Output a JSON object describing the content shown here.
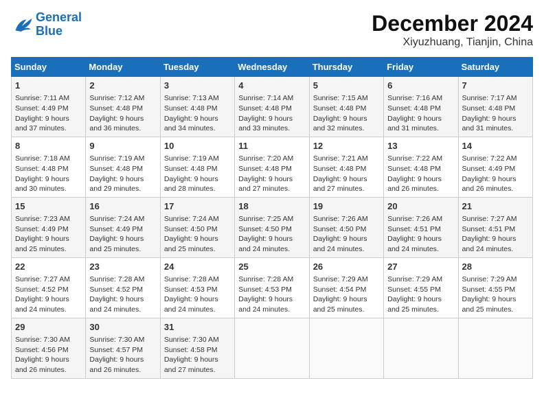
{
  "logo": {
    "line1": "General",
    "line2": "Blue"
  },
  "title": "December 2024",
  "subtitle": "Xiyuzhuang, Tianjin, China",
  "weekdays": [
    "Sunday",
    "Monday",
    "Tuesday",
    "Wednesday",
    "Thursday",
    "Friday",
    "Saturday"
  ],
  "weeks": [
    [
      {
        "day": 1,
        "sunrise": "7:11 AM",
        "sunset": "4:49 PM",
        "daylight": "9 hours and 37 minutes."
      },
      {
        "day": 2,
        "sunrise": "7:12 AM",
        "sunset": "4:48 PM",
        "daylight": "9 hours and 36 minutes."
      },
      {
        "day": 3,
        "sunrise": "7:13 AM",
        "sunset": "4:48 PM",
        "daylight": "9 hours and 34 minutes."
      },
      {
        "day": 4,
        "sunrise": "7:14 AM",
        "sunset": "4:48 PM",
        "daylight": "9 hours and 33 minutes."
      },
      {
        "day": 5,
        "sunrise": "7:15 AM",
        "sunset": "4:48 PM",
        "daylight": "9 hours and 32 minutes."
      },
      {
        "day": 6,
        "sunrise": "7:16 AM",
        "sunset": "4:48 PM",
        "daylight": "9 hours and 31 minutes."
      },
      {
        "day": 7,
        "sunrise": "7:17 AM",
        "sunset": "4:48 PM",
        "daylight": "9 hours and 31 minutes."
      }
    ],
    [
      {
        "day": 8,
        "sunrise": "7:18 AM",
        "sunset": "4:48 PM",
        "daylight": "9 hours and 30 minutes."
      },
      {
        "day": 9,
        "sunrise": "7:19 AM",
        "sunset": "4:48 PM",
        "daylight": "9 hours and 29 minutes."
      },
      {
        "day": 10,
        "sunrise": "7:19 AM",
        "sunset": "4:48 PM",
        "daylight": "9 hours and 28 minutes."
      },
      {
        "day": 11,
        "sunrise": "7:20 AM",
        "sunset": "4:48 PM",
        "daylight": "9 hours and 27 minutes."
      },
      {
        "day": 12,
        "sunrise": "7:21 AM",
        "sunset": "4:48 PM",
        "daylight": "9 hours and 27 minutes."
      },
      {
        "day": 13,
        "sunrise": "7:22 AM",
        "sunset": "4:48 PM",
        "daylight": "9 hours and 26 minutes."
      },
      {
        "day": 14,
        "sunrise": "7:22 AM",
        "sunset": "4:49 PM",
        "daylight": "9 hours and 26 minutes."
      }
    ],
    [
      {
        "day": 15,
        "sunrise": "7:23 AM",
        "sunset": "4:49 PM",
        "daylight": "9 hours and 25 minutes."
      },
      {
        "day": 16,
        "sunrise": "7:24 AM",
        "sunset": "4:49 PM",
        "daylight": "9 hours and 25 minutes."
      },
      {
        "day": 17,
        "sunrise": "7:24 AM",
        "sunset": "4:50 PM",
        "daylight": "9 hours and 25 minutes."
      },
      {
        "day": 18,
        "sunrise": "7:25 AM",
        "sunset": "4:50 PM",
        "daylight": "9 hours and 24 minutes."
      },
      {
        "day": 19,
        "sunrise": "7:26 AM",
        "sunset": "4:50 PM",
        "daylight": "9 hours and 24 minutes."
      },
      {
        "day": 20,
        "sunrise": "7:26 AM",
        "sunset": "4:51 PM",
        "daylight": "9 hours and 24 minutes."
      },
      {
        "day": 21,
        "sunrise": "7:27 AM",
        "sunset": "4:51 PM",
        "daylight": "9 hours and 24 minutes."
      }
    ],
    [
      {
        "day": 22,
        "sunrise": "7:27 AM",
        "sunset": "4:52 PM",
        "daylight": "9 hours and 24 minutes."
      },
      {
        "day": 23,
        "sunrise": "7:28 AM",
        "sunset": "4:52 PM",
        "daylight": "9 hours and 24 minutes."
      },
      {
        "day": 24,
        "sunrise": "7:28 AM",
        "sunset": "4:53 PM",
        "daylight": "9 hours and 24 minutes."
      },
      {
        "day": 25,
        "sunrise": "7:28 AM",
        "sunset": "4:53 PM",
        "daylight": "9 hours and 24 minutes."
      },
      {
        "day": 26,
        "sunrise": "7:29 AM",
        "sunset": "4:54 PM",
        "daylight": "9 hours and 25 minutes."
      },
      {
        "day": 27,
        "sunrise": "7:29 AM",
        "sunset": "4:55 PM",
        "daylight": "9 hours and 25 minutes."
      },
      {
        "day": 28,
        "sunrise": "7:29 AM",
        "sunset": "4:55 PM",
        "daylight": "9 hours and 25 minutes."
      }
    ],
    [
      {
        "day": 29,
        "sunrise": "7:30 AM",
        "sunset": "4:56 PM",
        "daylight": "9 hours and 26 minutes."
      },
      {
        "day": 30,
        "sunrise": "7:30 AM",
        "sunset": "4:57 PM",
        "daylight": "9 hours and 26 minutes."
      },
      {
        "day": 31,
        "sunrise": "7:30 AM",
        "sunset": "4:58 PM",
        "daylight": "9 hours and 27 minutes."
      },
      null,
      null,
      null,
      null
    ]
  ]
}
